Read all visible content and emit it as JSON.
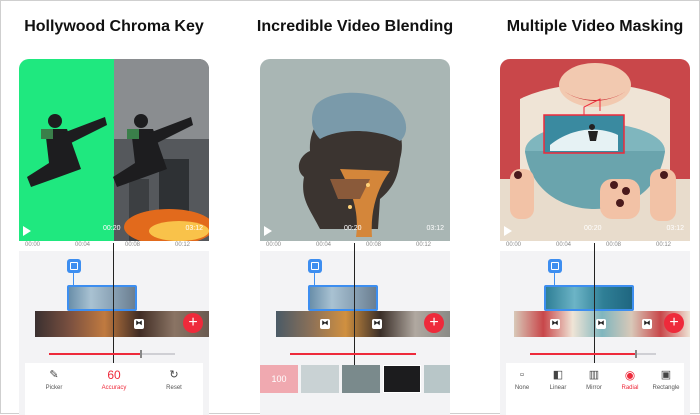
{
  "panels": [
    {
      "caption": "Hollywood Chroma Key",
      "time_current": "00:20",
      "time_total": "03:12",
      "ruler": [
        "00:00",
        "00:04",
        "00:08",
        "00:12"
      ],
      "tools": [
        {
          "icon": "pencil-icon",
          "label": "Picker"
        },
        {
          "value": "60",
          "label": "Accuracy"
        },
        {
          "icon": "reset-icon",
          "label": "Reset"
        }
      ],
      "slider_value": 0.72
    },
    {
      "caption": "Incredible Video Blending",
      "time_current": "00:20",
      "time_total": "03:12",
      "ruler": [
        "00:00",
        "00:04",
        "00:08",
        "00:12"
      ],
      "thumbs": [
        "100",
        "",
        "",
        "",
        ""
      ],
      "slider_value": 1.0
    },
    {
      "caption": "Multiple Video Masking",
      "time_current": "00:20",
      "time_total": "03:12",
      "ruler": [
        "00:00",
        "00:04",
        "00:08",
        "00:12"
      ],
      "tools": [
        {
          "icon": "none-icon",
          "label": "None"
        },
        {
          "icon": "linear-icon",
          "label": "Linear"
        },
        {
          "icon": "mirror-icon",
          "label": "Mirror"
        },
        {
          "icon": "radial-icon",
          "label": "Radial"
        },
        {
          "icon": "rectangle-icon",
          "label": "Rectangle"
        }
      ],
      "slider_value": 0.83
    }
  ],
  "colors": {
    "accent": "#ee2a3b",
    "chroma_green": "#1fe87f",
    "overlay_blue": "#3d8ef0"
  }
}
